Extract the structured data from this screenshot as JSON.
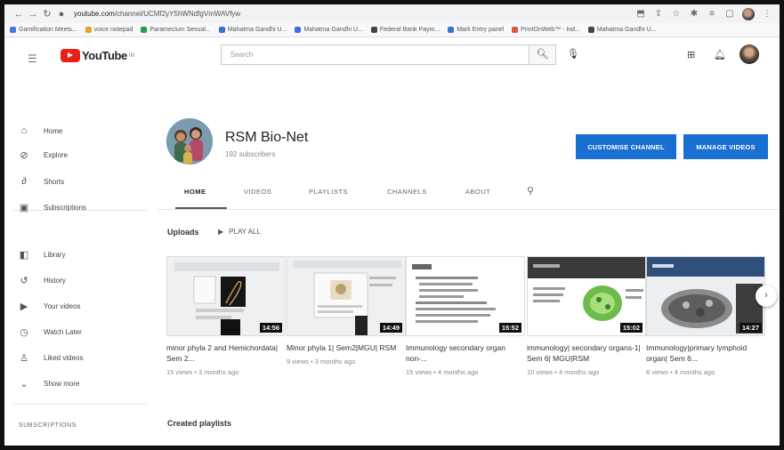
{
  "browser": {
    "url_host": "youtube.com",
    "url_path": "/channel/UCMf2yY5hWNdfgVmWAVfyw",
    "bookmarks": [
      {
        "label": "Gamification Meets...",
        "color": "#3d7be0"
      },
      {
        "label": "voice notepad",
        "color": "#f0a02a"
      },
      {
        "label": "Paramecium Sexual...",
        "color": "#2c9b4f"
      },
      {
        "label": "Mahatma Gandhi U...",
        "color": "#3d6fd8"
      },
      {
        "label": "Mahatma Gandhi U...",
        "color": "#3d6fd8"
      },
      {
        "label": "Federal Bank Paym...",
        "color": "#444444"
      },
      {
        "label": "Mark Entry panel",
        "color": "#3d6fd8"
      },
      {
        "label": "PrintOnWeb™ - Ind...",
        "color": "#e0533d"
      },
      {
        "label": "Mahatma Gandhi U...",
        "color": "#444444"
      }
    ]
  },
  "header": {
    "logo_text": "YouTube",
    "logo_sup": "IN",
    "search_placeholder": "Search",
    "icons": [
      "menu-icon",
      "search-icon",
      "mic-icon",
      "create-icon",
      "bell-icon"
    ]
  },
  "sidebar": {
    "items": [
      {
        "label": "Home",
        "icon": "home-icon",
        "glyph": "⌂"
      },
      {
        "label": "Explore",
        "icon": "compass-icon",
        "glyph": "⊘"
      },
      {
        "label": "Shorts",
        "icon": "shorts-icon",
        "glyph": "∂"
      },
      {
        "label": "Subscriptions",
        "icon": "subscriptions-icon",
        "glyph": "▣"
      },
      {
        "label": "Library",
        "icon": "library-icon",
        "glyph": "◧"
      },
      {
        "label": "History",
        "icon": "history-icon",
        "glyph": "↺"
      },
      {
        "label": "Your videos",
        "icon": "your-videos-icon",
        "glyph": "▶"
      },
      {
        "label": "Watch Later",
        "icon": "clock-icon",
        "glyph": "◷"
      },
      {
        "label": "Liked videos",
        "icon": "thumbs-up-icon",
        "glyph": "♙"
      },
      {
        "label": "Show more",
        "icon": "chevron-down-icon",
        "glyph": "⌄"
      }
    ],
    "subscriptions_heading": "SUBSCRIPTIONS"
  },
  "channel": {
    "name": "RSM Bio-Net",
    "subscribers": "192 subscribers",
    "customise_label": "CUSTOMISE CHANNEL",
    "manage_label": "MANAGE VIDEOS",
    "accent_color": "#1a6fd3",
    "tabs": [
      "HOME",
      "VIDEOS",
      "PLAYLISTS",
      "CHANNELS",
      "ABOUT"
    ],
    "active_tab": "HOME"
  },
  "uploads": {
    "heading": "Uploads",
    "play_all": "PLAY ALL",
    "videos": [
      {
        "title": "minor phyla 2 and Hemichordata| Sem 2...",
        "meta": "15 views • 3 months ago",
        "duration": "14:56"
      },
      {
        "title": "Minor phyla 1| Sem2|MGU| RSM",
        "meta": "9 views • 3 months ago",
        "duration": "14:49"
      },
      {
        "title": "Immunology secondary organ non-...",
        "meta": "15 views • 4 months ago",
        "duration": "15:52"
      },
      {
        "title": "immunology| secondary organs-1| Sem 6| MGU|RSM",
        "meta": "10 views • 4 months ago",
        "duration": "15:02"
      },
      {
        "title": "Immunology|primary lymphoid organ| Sem 6...",
        "meta": "8 views • 4 months ago",
        "duration": "14:27"
      }
    ]
  },
  "created_playlists": "Created playlists"
}
